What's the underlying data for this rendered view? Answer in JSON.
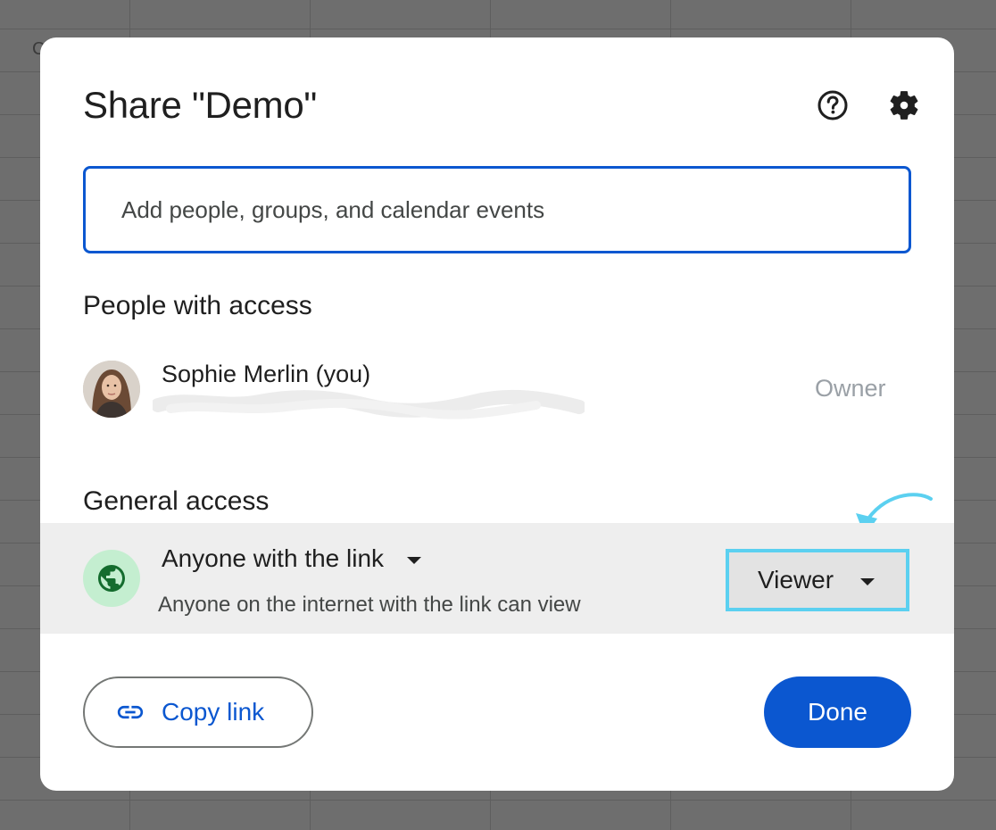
{
  "background": {
    "cell_letter": "C"
  },
  "dialog": {
    "title": "Share \"Demo\"",
    "help_icon": "help-circle-icon",
    "settings_icon": "gear-icon",
    "input": {
      "value": "",
      "placeholder": "Add people, groups, and calendar events"
    },
    "people_section": {
      "heading": "People with access",
      "people": [
        {
          "name": "Sophie Merlin (you)",
          "email_redacted": true,
          "role": "Owner"
        }
      ]
    },
    "general_section": {
      "heading": "General access",
      "access_option": "Anyone with the link",
      "access_description": "Anyone on the internet with the link can view",
      "role": "Viewer",
      "globe_icon": "globe-icon"
    },
    "actions": {
      "copy_link_label": "Copy link",
      "copy_link_icon": "link-icon",
      "done_label": "Done"
    }
  },
  "colors": {
    "accent": "#0b57d0",
    "highlight_outline": "#5bd0f0",
    "globe_badge_bg": "#c4eed0",
    "globe_icon": "#146c2e"
  }
}
